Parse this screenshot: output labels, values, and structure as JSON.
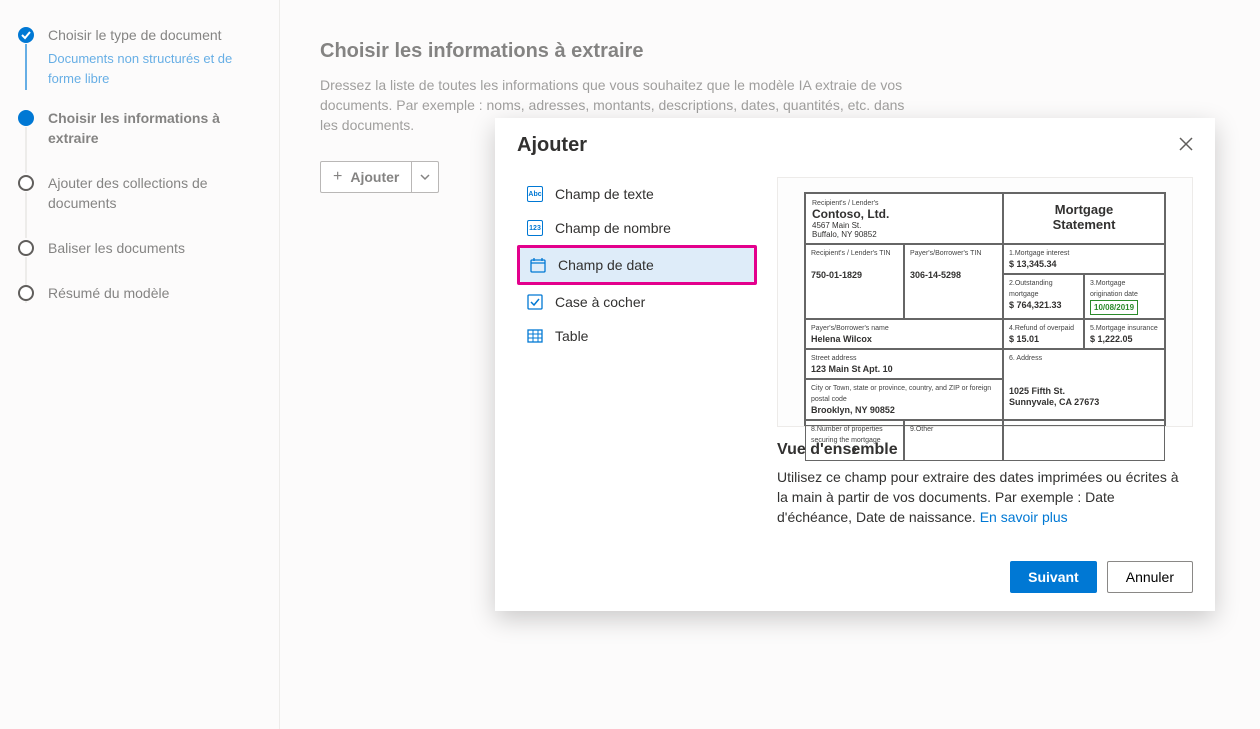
{
  "sidebar": {
    "steps": [
      {
        "label": "Choisir le type de document",
        "sublabel": "Documents non structurés et de forme libre"
      },
      {
        "label": "Choisir les informations à extraire"
      },
      {
        "label": "Ajouter des collections de documents"
      },
      {
        "label": "Baliser les documents"
      },
      {
        "label": "Résumé du modèle"
      }
    ]
  },
  "main": {
    "title": "Choisir les informations à extraire",
    "description": "Dressez la liste de toutes les informations que vous souhaitez que le modèle IA extraie de vos documents. Par exemple : noms, adresses, montants, descriptions, dates, quantités, etc. dans les documents.",
    "add_label": "Ajouter"
  },
  "dialog": {
    "title": "Ajouter",
    "types": [
      {
        "label": "Champ de texte",
        "icon": "Abc"
      },
      {
        "label": "Champ de nombre",
        "icon": "123"
      },
      {
        "label": "Champ de date",
        "icon": "📅"
      },
      {
        "label": "Case à cocher",
        "icon": "✓"
      },
      {
        "label": "Table",
        "icon": "☰"
      }
    ],
    "overview_title": "Vue d'ensemble",
    "overview_text": "Utilisez ce champ pour extraire des dates imprimées ou écrites à la main à partir de vos documents. Par exemple : Date d'échéance, Date de naissance. ",
    "learn_more": "En savoir plus",
    "next": "Suivant",
    "cancel": "Annuler",
    "preview_doc": {
      "sender_label": "Recipient's / Lender's",
      "sender_name": "Contoso, Ltd.",
      "sender_addr1": "4567 Main St.",
      "sender_addr2": "Buffalo, NY 90852",
      "doc_title1": "Mortgage",
      "doc_title2": "Statement",
      "tin1_label": "Recipient's / Lender's TIN",
      "tin1": "750-01-1829",
      "tin2_label": "Payer's/Borrower's TIN",
      "tin2": "306-14-5298",
      "f1_label": "1.Mortgage interest",
      "f1": "$ 13,345.34",
      "f2_label": "2.Outstanding mortgage",
      "f2": "$  764,321.33",
      "f3_label": "3.Mortgage origination date",
      "f3": "10/08/2019",
      "f4_label": "4.Refund of overpaid",
      "f4": "$   15.01",
      "f5_label": "5.Mortgage insurance",
      "f5": "$  1,222.05",
      "f6_label": "6. Address",
      "payer_label": "Payer's/Borrower's name",
      "payer": "Helena Wilcox",
      "street_label": "Street address",
      "street": "123 Main St Apt. 10",
      "city_label": "City or Town, state or province, country, and ZIP or foreign postal code",
      "city": "Brooklyn, NY 90852",
      "addr2_1": "1025 Fifth St.",
      "addr2_2": "Sunnyvale, CA 27673",
      "props_label": "8.Number of properties securing the mortgage",
      "props": "2",
      "other_label": "9.Other"
    }
  }
}
